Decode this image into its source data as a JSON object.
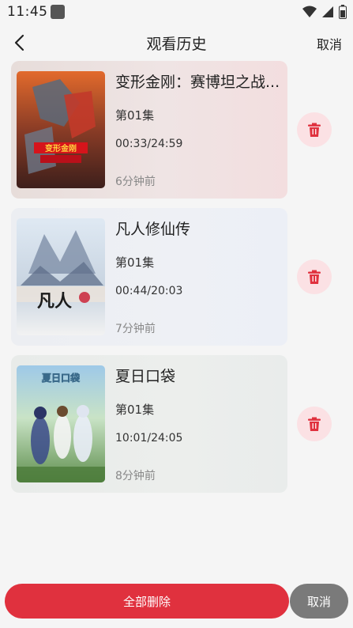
{
  "status_bar": {
    "time": "11:45"
  },
  "header": {
    "title": "观看历史",
    "cancel_label": "取消"
  },
  "items": [
    {
      "title": "变形金刚：赛博坦之战...",
      "episode": "第01集",
      "progress": "00:33/24:59",
      "time_ago": "6分钟前",
      "poster_text": "变形金刚"
    },
    {
      "title": "凡人修仙传",
      "episode": "第01集",
      "progress": "00:44/20:03",
      "time_ago": "7分钟前",
      "poster_text": "凡人"
    },
    {
      "title": "夏日口袋",
      "episode": "第01集",
      "progress": "10:01/24:05",
      "time_ago": "8分钟前",
      "poster_text": "夏日口袋"
    }
  ],
  "footer": {
    "delete_all_label": "全部删除",
    "cancel_label": "取消"
  },
  "colors": {
    "accent": "#e0313e",
    "delete_bg": "#fbe1e4",
    "cancel_bg": "#7a7a7a"
  }
}
